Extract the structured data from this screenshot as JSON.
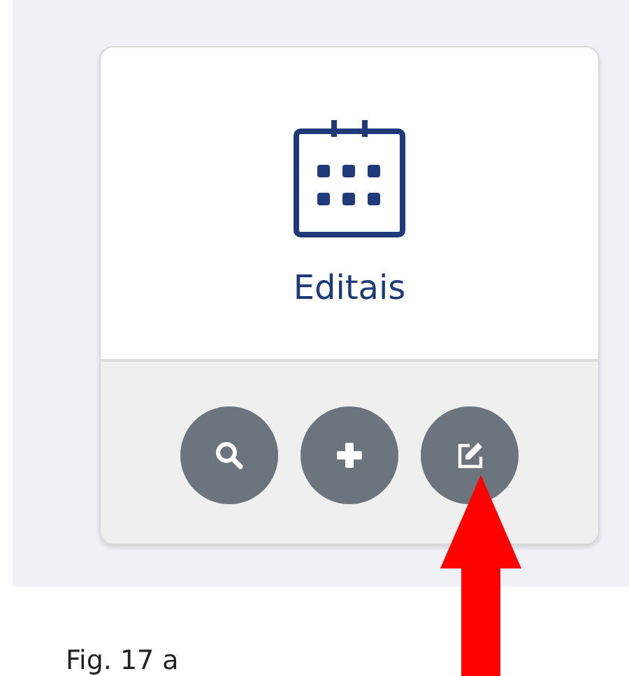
{
  "card": {
    "title": "Editais",
    "buttons": [
      {
        "kind": "search"
      },
      {
        "kind": "add"
      },
      {
        "kind": "edit"
      }
    ]
  },
  "caption": "Fig. 17 a"
}
